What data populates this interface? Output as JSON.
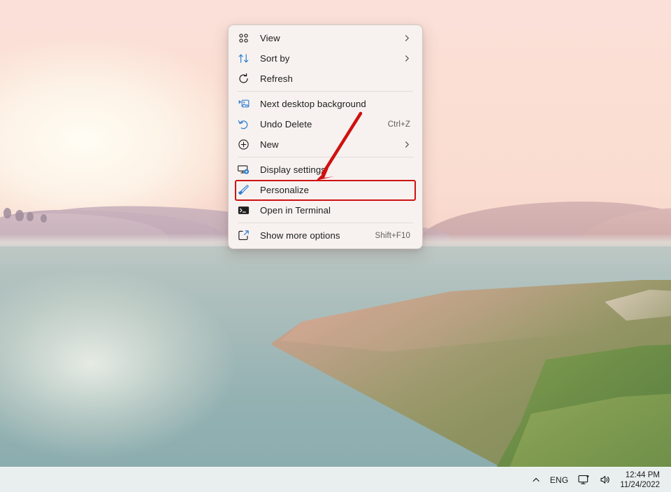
{
  "desktop": {
    "wallpaper_name": "sunrise-lake-wallpaper",
    "accent_red": "#cf1111"
  },
  "context_menu": {
    "groups": [
      {
        "items": [
          {
            "label": "View",
            "icon": "grid-view-icon",
            "accel": "",
            "submenu": true,
            "highlighted": false
          },
          {
            "label": "Sort by",
            "icon": "sort-arrows-icon",
            "accel": "",
            "submenu": true,
            "highlighted": false
          },
          {
            "label": "Refresh",
            "icon": "refresh-icon",
            "accel": "",
            "submenu": false,
            "highlighted": false
          }
        ]
      },
      {
        "items": [
          {
            "label": "Next desktop background",
            "icon": "next-desktop-background-icon",
            "accel": "",
            "submenu": false,
            "highlighted": false
          },
          {
            "label": "Undo Delete",
            "icon": "undo-icon",
            "accel": "Ctrl+Z",
            "submenu": false,
            "highlighted": false
          },
          {
            "label": "New",
            "icon": "plus-circle-icon",
            "accel": "",
            "submenu": true,
            "highlighted": false
          }
        ]
      },
      {
        "items": [
          {
            "label": "Display settings",
            "icon": "monitor-settings-icon",
            "accel": "",
            "submenu": false,
            "highlighted": false
          },
          {
            "label": "Personalize",
            "icon": "paintbrush-icon",
            "accel": "",
            "submenu": false,
            "highlighted": true
          },
          {
            "label": "Open in Terminal",
            "icon": "terminal-icon",
            "accel": "",
            "submenu": false,
            "highlighted": false
          }
        ]
      },
      {
        "items": [
          {
            "label": "Show more options",
            "icon": "show-more-options-icon",
            "accel": "Shift+F10",
            "submenu": false,
            "highlighted": false
          }
        ]
      }
    ]
  },
  "taskbar": {
    "chevron_label": "⌃",
    "language": "ENG",
    "network_icon": "network-display-icon",
    "volume_icon": "speaker-icon",
    "time": "12:44 PM",
    "date": "11/24/2022"
  }
}
